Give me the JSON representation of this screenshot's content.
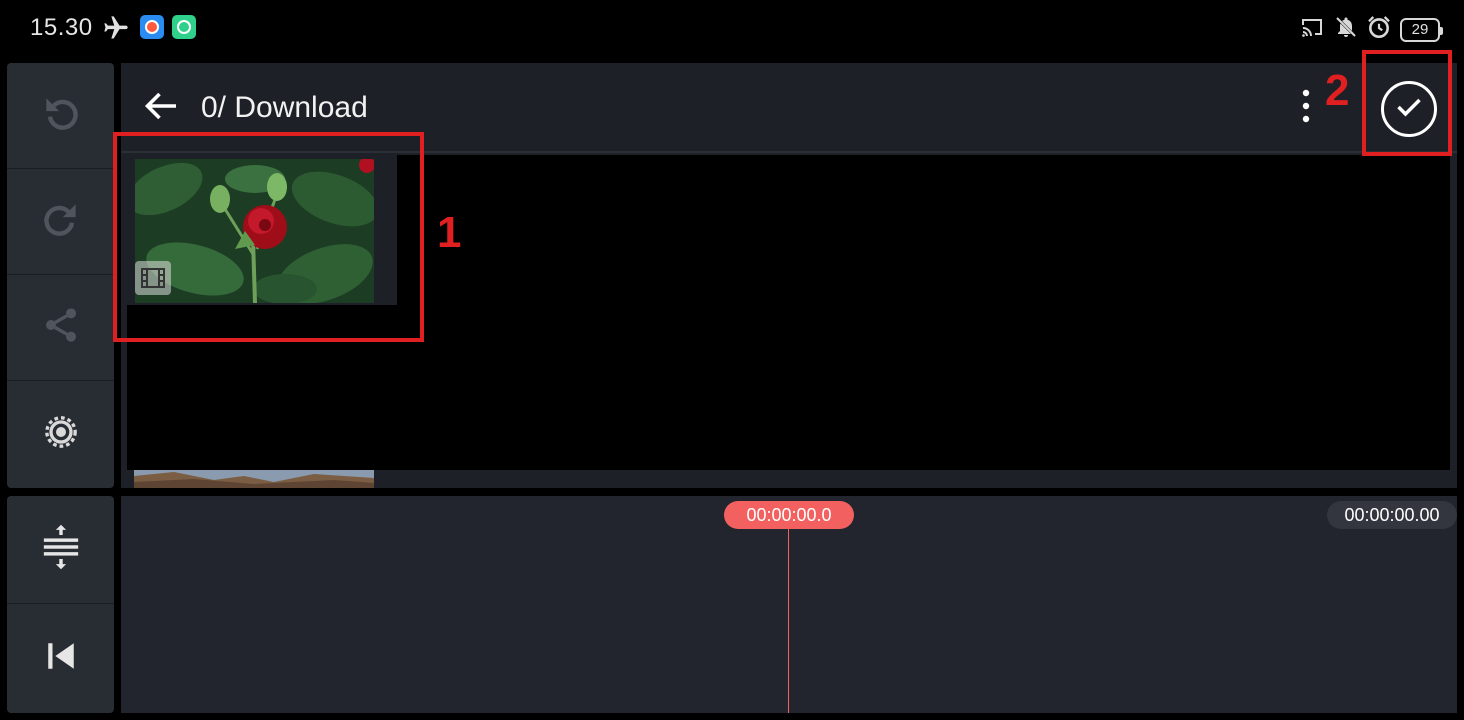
{
  "status_bar": {
    "time": "15.30",
    "battery": "29",
    "icons": [
      "airplane-icon",
      "app-icon-1",
      "app-icon-2",
      "cast-icon",
      "notifications-off-icon",
      "alarm-icon",
      "battery-icon"
    ]
  },
  "left_toolbar": {
    "items": [
      "undo-icon",
      "redo-icon",
      "share-icon",
      "settings-icon"
    ],
    "bottom_items": [
      "track-adjust-icon",
      "skip-to-start-icon"
    ]
  },
  "browser": {
    "path_title": "0/ Download",
    "media_items": [
      {
        "type": "video",
        "icon": "film-icon"
      }
    ]
  },
  "timeline": {
    "playhead_time": "00:00:00.0",
    "total_time": "00:00:00.00"
  },
  "annotations": {
    "box1_label": "1",
    "box2_label": "2",
    "color": "#e02020"
  },
  "colors": {
    "accent": "#f36060",
    "panel": "#282c33",
    "background": "#1d2026"
  }
}
